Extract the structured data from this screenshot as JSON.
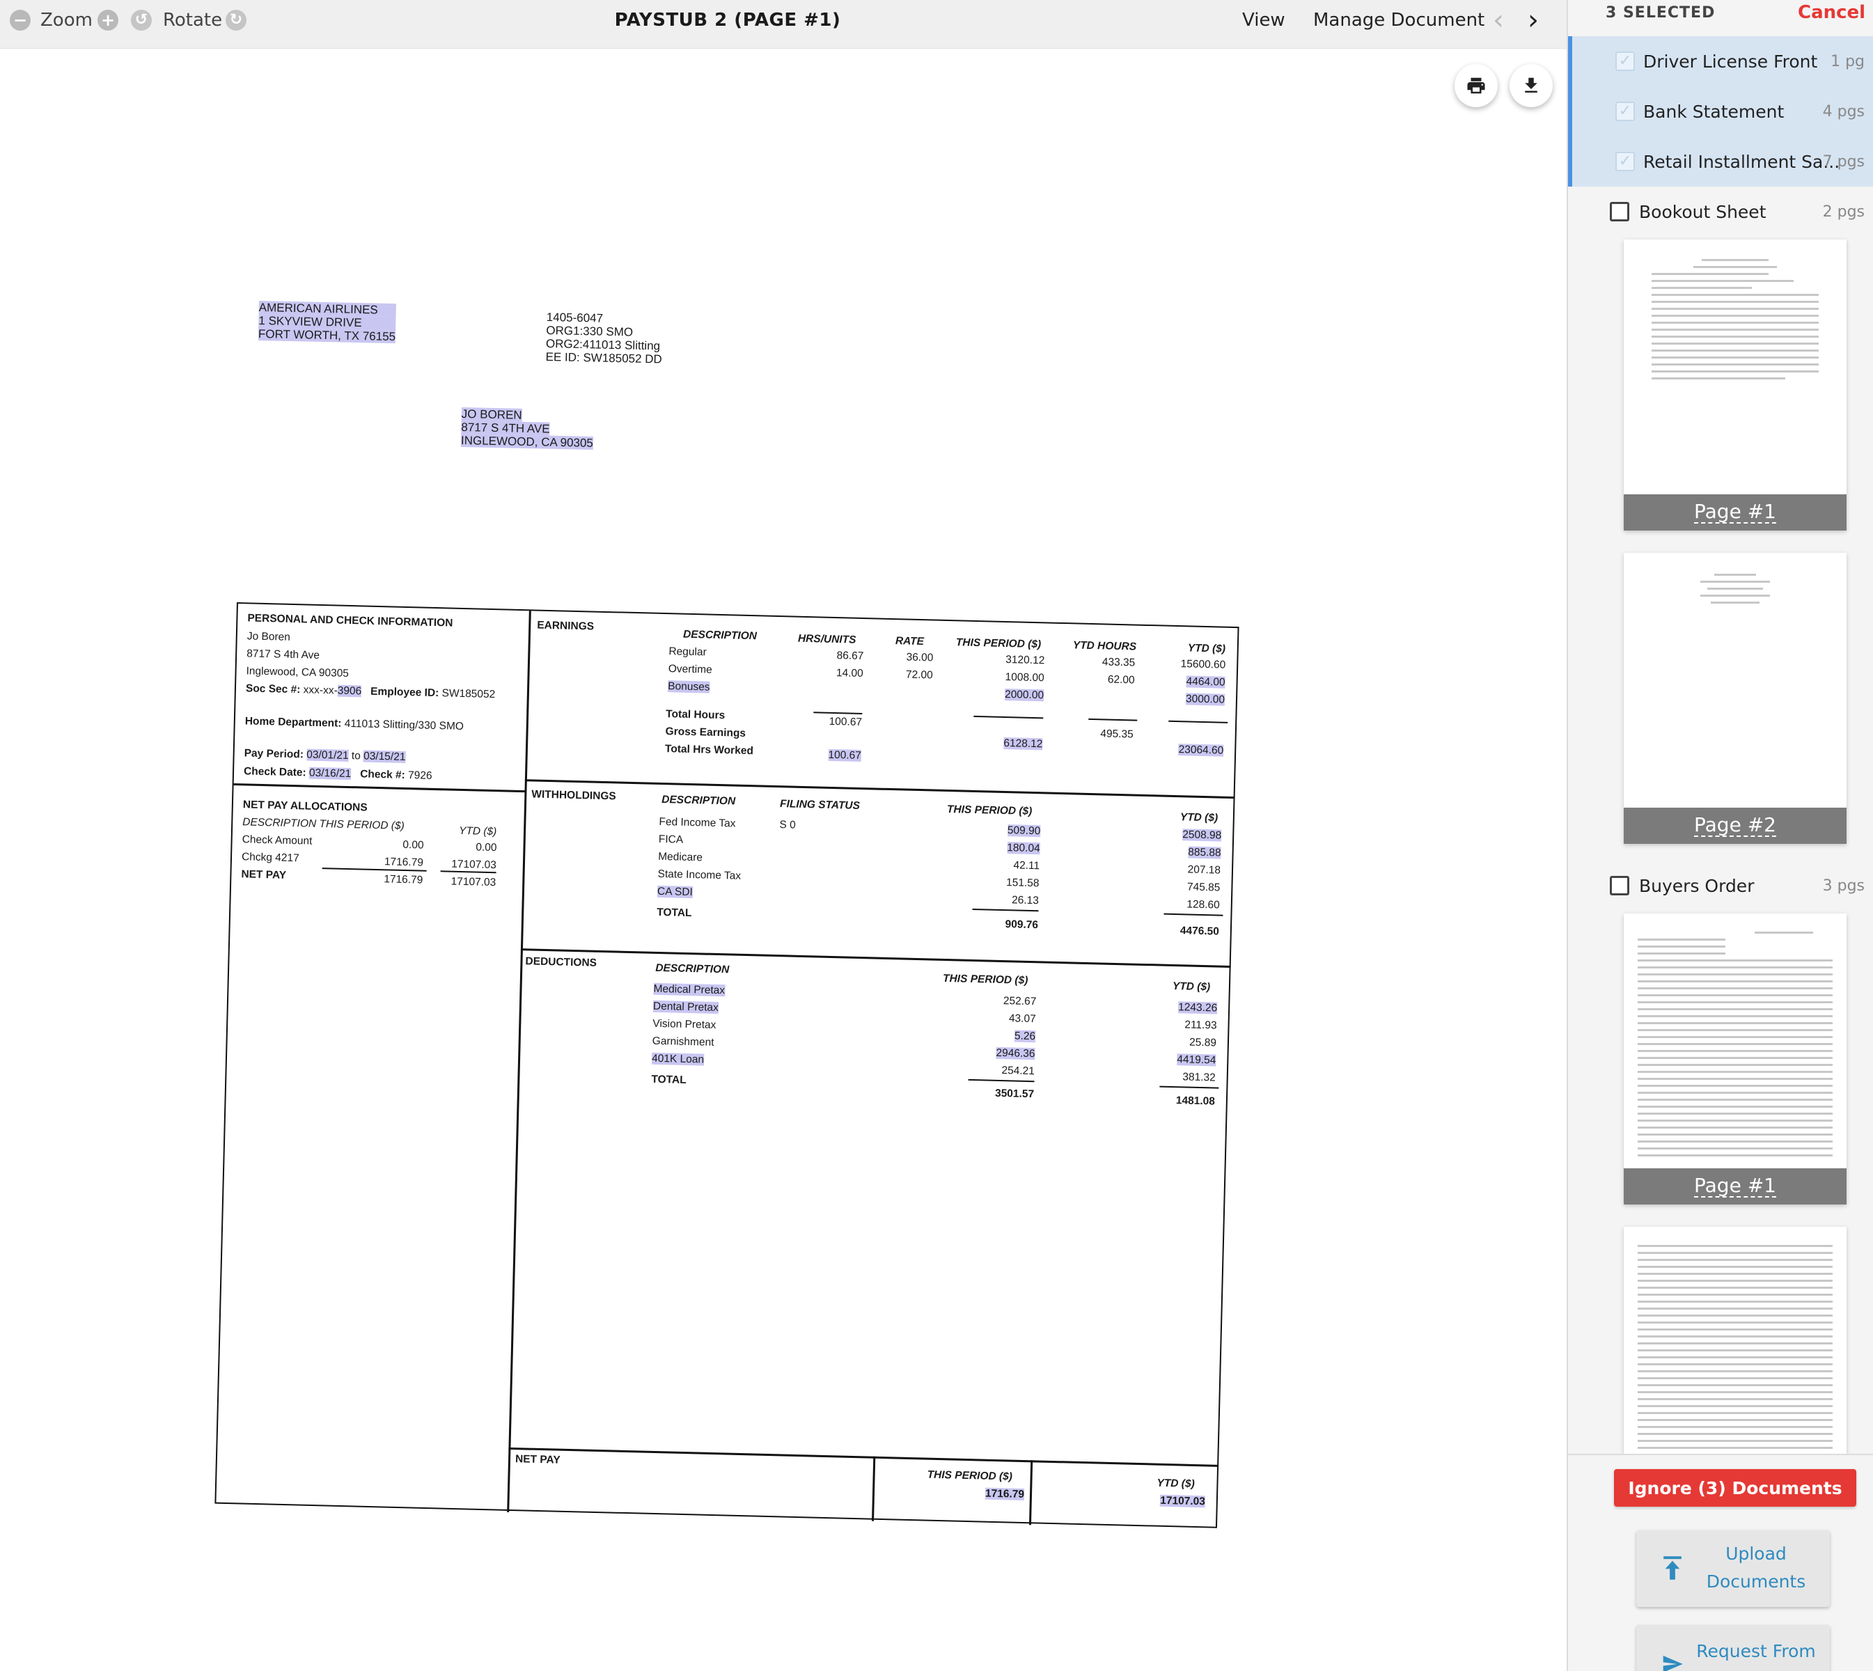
{
  "toolbar": {
    "zoom_label": "Zoom",
    "rotate_label": "Rotate",
    "title": "PAYSTUB 2 (PAGE #1)",
    "view_label": "View",
    "manage_label": "Manage Document"
  },
  "employer": {
    "line1": "AMERICAN AIRLINES",
    "line2": "1 SKYVIEW DRIVE",
    "line3": "FORT WORTH, TX 76155"
  },
  "codes": {
    "line1": "1405-6047",
    "line2": "ORG1:330 SMO",
    "line3": "ORG2:411013 Slitting",
    "line4": "EE ID: SW185052 DD"
  },
  "employee": {
    "line1": "JO BOREN",
    "line2": "8717 S 4TH AVE",
    "line3_a": "INGLEWOOD, ",
    "line3_b": "CA 90305"
  },
  "personal": {
    "header": "PERSONAL AND CHECK INFORMATION",
    "name": "Jo Boren",
    "street": "8717 S 4th Ave",
    "city": "Inglewood, CA 90305",
    "ssn_label": "Soc Sec #: ",
    "ssn_prefix": "xxx-xx-",
    "ssn_last": "3906",
    "emp_label": "Employee ID: ",
    "emp_id": "SW185052",
    "dept_label": "Home Department: ",
    "dept": "411013 Slitting/330 SMO",
    "pay_period_label": "Pay Period: ",
    "period_start": "03/01/21",
    "period_to": " to ",
    "period_end": "03/15/21",
    "check_date_label": "Check Date: ",
    "check_date": "03/16/21",
    "check_num_label": "Check #: ",
    "check_num": "7926"
  },
  "net_alloc": {
    "header": "NET PAY ALLOCATIONS",
    "col_desc": "DESCRIPTION",
    "col_period": "THIS PERIOD ($)",
    "col_ytd": "YTD ($)",
    "rows": [
      {
        "desc": "Check Amount",
        "period": "0.00",
        "ytd": "0.00"
      },
      {
        "desc": "Chckg 4217",
        "period": "1716.79",
        "ytd": "17107.03"
      }
    ],
    "total_label": "NET PAY",
    "total_period": "1716.79",
    "total_ytd": "17107.03"
  },
  "earnings": {
    "header": "EARNINGS",
    "col_desc": "DESCRIPTION",
    "col_hrs": "HRS/UNITS",
    "col_rate": "RATE",
    "col_period": "THIS PERIOD ($)",
    "col_ytd_hours": "YTD HOURS",
    "col_ytd": "YTD ($)",
    "rows": [
      {
        "desc": "Regular",
        "hrs": "86.67",
        "rate": "36.00",
        "period": "3120.12",
        "ytd_hours": "433.35",
        "ytd": "15600.60"
      },
      {
        "desc": "Overtime",
        "hrs": "14.00",
        "rate": "72.00",
        "period": "1008.00",
        "ytd_hours": "62.00",
        "ytd": "4464.00"
      },
      {
        "desc": "Bonuses",
        "hrs": "",
        "rate": "",
        "period": "2000.00",
        "ytd_hours": "",
        "ytd": "3000.00"
      }
    ],
    "total_hours_label": "Total Hours",
    "total_hours": "100.67",
    "total_ytd_hours": "495.35",
    "gross_label": "Gross Earnings",
    "gross_period": "6128.12",
    "gross_ytd": "23064.60",
    "worked_label": "Total Hrs Worked",
    "worked_hours": "100.67"
  },
  "withholdings": {
    "header": "WITHHOLDINGS",
    "col_desc": "DESCRIPTION",
    "col_filing": "FILING STATUS",
    "col_period": "THIS PERIOD ($)",
    "col_ytd": "YTD ($)",
    "rows": [
      {
        "desc": "Fed Income Tax",
        "filing": "S 0",
        "period": "509.90",
        "ytd": "2508.98"
      },
      {
        "desc": "FICA",
        "filing": "",
        "period": "180.04",
        "ytd": "885.88"
      },
      {
        "desc": "Medicare",
        "filing": "",
        "period": "42.11",
        "ytd": "207.18"
      },
      {
        "desc": "State Income Tax",
        "filing": "",
        "period": "151.58",
        "ytd": "745.85"
      },
      {
        "desc": "CA SDI",
        "filing": "",
        "period": "26.13",
        "ytd": "128.60"
      }
    ],
    "total_label": "TOTAL",
    "total_period": "909.76",
    "total_ytd": "4476.50"
  },
  "deductions": {
    "header": "DEDUCTIONS",
    "col_desc": "DESCRIPTION",
    "col_period": "THIS PERIOD ($)",
    "col_ytd": "YTD ($)",
    "rows": [
      {
        "desc": "Medical Pretax",
        "period": "252.67",
        "ytd": "1243.26"
      },
      {
        "desc": "Dental Pretax",
        "period": "43.07",
        "ytd": "211.93"
      },
      {
        "desc": "Vision Pretax",
        "period": "5.26",
        "ytd": "25.89"
      },
      {
        "desc": "Garnishment",
        "period": "2946.36",
        "ytd": "4419.54"
      },
      {
        "desc": "401K Loan",
        "period": "254.21",
        "ytd": "381.32"
      }
    ],
    "total_label": "TOTAL",
    "total_period": "3501.57",
    "total_ytd": "1481.08"
  },
  "net_pay": {
    "header": "NET PAY",
    "col_period": "THIS PERIOD ($)",
    "col_ytd": "YTD ($)",
    "period": "1716.79",
    "ytd": "17107.03"
  },
  "panel": {
    "selected_count": "3 SELECTED",
    "cancel_label": "Cancel",
    "selected_docs": [
      {
        "name": "Driver License Front",
        "pages": "1 pg"
      },
      {
        "name": "Bank Statement",
        "pages": "4 pgs"
      },
      {
        "name": "Retail Installment Sa...",
        "pages": "7 pgs"
      }
    ],
    "bookout": {
      "name": "Bookout Sheet",
      "pages": "2 pgs",
      "page1": "Page #1",
      "page2": "Page #2"
    },
    "buyers": {
      "name": "Buyers Order",
      "pages": "3 pgs",
      "page1": "Page #1"
    },
    "ignore_label": "Ignore (3) Documents",
    "upload_line1": "Upload",
    "upload_line2": "Documents",
    "request_label": "Request From"
  },
  "colors": {
    "accent_red": "#e53935",
    "accent_blue": "#2e8bc0",
    "selected_row": "#d6e4f2",
    "highlight": "#c9c6f2"
  }
}
